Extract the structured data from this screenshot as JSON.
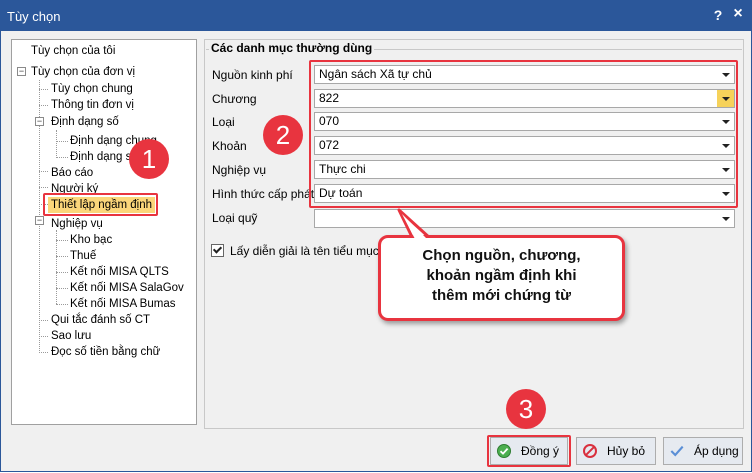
{
  "window": {
    "title": "Tùy chọn",
    "help_label": "?",
    "close_label": "×"
  },
  "tree": {
    "items": [
      {
        "label": "Tùy chọn của tôi"
      },
      {
        "label": "Tùy chọn của đơn vị"
      },
      {
        "label": "Tùy chọn chung"
      },
      {
        "label": "Thông tin đơn vị"
      },
      {
        "label": "Định dạng số"
      },
      {
        "label": "Định dạng chung"
      },
      {
        "label": "Định dạng s"
      },
      {
        "label": "Báo cáo"
      },
      {
        "label": "Người ký"
      },
      {
        "label": "Thiết lập ngầm định"
      },
      {
        "label": "Nghiệp vụ"
      },
      {
        "label": "Kho bạc"
      },
      {
        "label": "Thuế"
      },
      {
        "label": "Kết nối MISA QLTS"
      },
      {
        "label": "Kết nối MISA SalaGov"
      },
      {
        "label": "Kết nối MISA Bumas"
      },
      {
        "label": "Qui tắc đánh số CT"
      },
      {
        "label": "Sao lưu"
      },
      {
        "label": "Đọc số tiền bằng chữ"
      }
    ],
    "collapse_symbol": "−"
  },
  "form": {
    "group_title": "Các danh mục thường dùng",
    "fields": [
      {
        "label": "Nguồn kinh phí",
        "value": "Ngân sách Xã tự chủ"
      },
      {
        "label": "Chương",
        "value": "822"
      },
      {
        "label": "Loại",
        "value": "070"
      },
      {
        "label": "Khoản",
        "value": "072"
      },
      {
        "label": "Nghiệp vụ",
        "value": "Thực chi"
      },
      {
        "label": "Hình thức cấp phát",
        "value": "Dự toán"
      },
      {
        "label": "Loại quỹ",
        "value": ""
      }
    ],
    "checkbox_label": "Lấy diễn giải là tên tiểu mục",
    "checkbox_checked": true
  },
  "callout": {
    "line1": "Chọn nguồn, chương,",
    "line2": "khoản ngầm định khi",
    "line3": "thêm mới chứng từ"
  },
  "badges": {
    "b1": "1",
    "b2": "2",
    "b3": "3"
  },
  "buttons": {
    "ok_label": "Đồng ý",
    "cancel_label": "Hủy bỏ",
    "apply_label": "Áp dụng"
  },
  "colors": {
    "titlebar": "#2b579a",
    "accent_red": "#e8343f",
    "selected_tree": "#fbd67a",
    "dropdown_highlight": "#f6d25a"
  }
}
